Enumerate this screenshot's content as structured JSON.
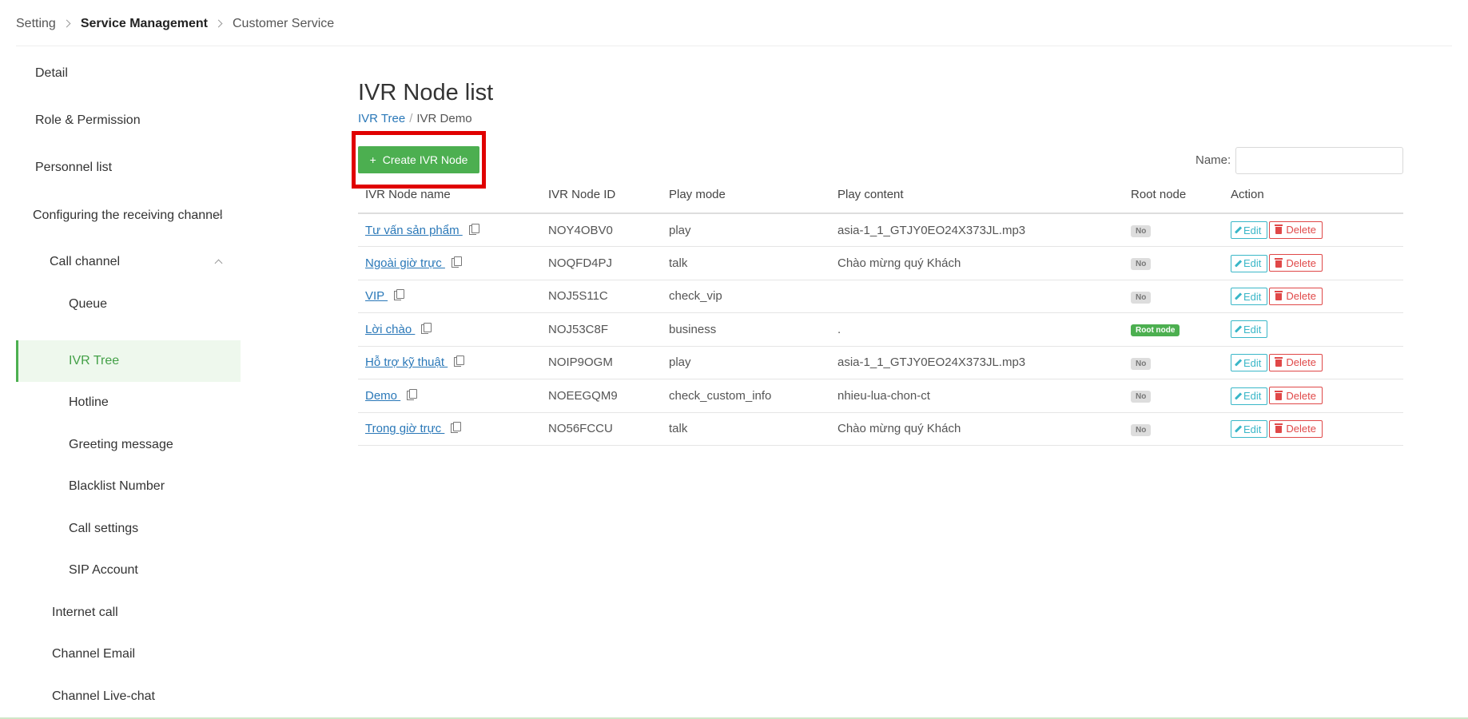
{
  "breadcrumb": [
    "Setting",
    "Service Management",
    "Customer Service"
  ],
  "sidebar": {
    "items": [
      {
        "label": "Detail"
      },
      {
        "label": "Role & Permission"
      },
      {
        "label": "Personnel list"
      },
      {
        "label": "Configuring the receiving channel"
      },
      {
        "label": "Call channel"
      },
      {
        "label": "Queue"
      },
      {
        "label": "IVR Tree"
      },
      {
        "label": "Hotline"
      },
      {
        "label": "Greeting message"
      },
      {
        "label": "Blacklist Number"
      },
      {
        "label": "Call settings"
      },
      {
        "label": "SIP Account"
      },
      {
        "label": "Internet call"
      },
      {
        "label": "Channel Email"
      },
      {
        "label": "Channel Live-chat"
      }
    ]
  },
  "main": {
    "title": "IVR Node list",
    "sub_breadcrumb": {
      "link": "IVR Tree",
      "separator": "/",
      "current": "IVR Demo"
    },
    "create_button": {
      "icon": "+",
      "label": "Create IVR Node"
    },
    "filter": {
      "name_label": "Name:",
      "name_value": ""
    }
  },
  "table": {
    "columns": [
      "IVR Node name",
      "IVR Node ID",
      "Play mode",
      "Play content",
      "Root node",
      "Action"
    ],
    "rows": [
      {
        "name": "Tư vấn sản phẩm ",
        "id": "NOY4OBV0",
        "mode": "play",
        "content": "asia-1_1_GTJY0EO24X373JL.mp3",
        "root": "No",
        "is_root": false
      },
      {
        "name": "Ngoài giờ trực ",
        "id": "NOQFD4PJ",
        "mode": "talk",
        "content": "Chào mừng quý Khách",
        "root": "No",
        "is_root": false
      },
      {
        "name": "VIP ",
        "id": "NOJ5S11C",
        "mode": "check_vip",
        "content": "",
        "root": "No",
        "is_root": false
      },
      {
        "name": "Lời chào ",
        "id": "NOJ53C8F",
        "mode": "business",
        "content": ".",
        "root": "Root node",
        "is_root": true
      },
      {
        "name": "Hỗ trợ kỹ thuật ",
        "id": "NOIP9OGM",
        "mode": "play",
        "content": "asia-1_1_GTJY0EO24X373JL.mp3",
        "root": "No",
        "is_root": false
      },
      {
        "name": "Demo ",
        "id": "NOEEGQM9",
        "mode": "check_custom_info",
        "content": "nhieu-lua-chon-ct",
        "root": "No",
        "is_root": false
      },
      {
        "name": "Trong giờ trực ",
        "id": "NO56FCCU",
        "mode": "talk",
        "content": "Chào mừng quý Khách",
        "root": "No",
        "is_root": false
      }
    ],
    "edit_label": "Edit",
    "delete_label": "Delete"
  },
  "colors": {
    "accent_green": "#4caf50",
    "link_blue": "#2a78b8",
    "edit_teal": "#3ab7c8",
    "delete_red": "#e04848",
    "highlight_red": "#e00000"
  }
}
